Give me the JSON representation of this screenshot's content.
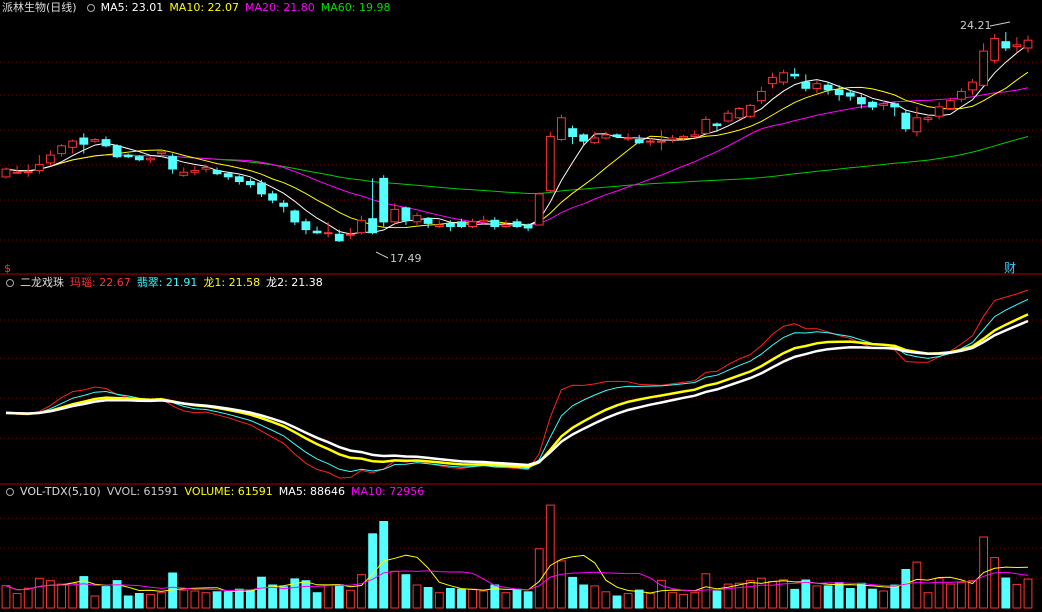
{
  "panels": {
    "main": {
      "stock_name": "派林生物(日线)",
      "indicators": [
        {
          "label": "MA5: 23.01",
          "color": "#ffffff"
        },
        {
          "label": "MA10: 22.07",
          "color": "#ffff00"
        },
        {
          "label": "MA20: 21.80",
          "color": "#ff00ff"
        },
        {
          "label": "MA60: 19.98",
          "color": "#00dd00"
        }
      ],
      "high_label": "24.21",
      "low_label": "17.49",
      "badge_left": "$",
      "badge_right": "财"
    },
    "mid": {
      "title": "二龙戏珠",
      "indicators": [
        {
          "label": "玛瑙: 22.67",
          "color": "#ff3333"
        },
        {
          "label": "翡翠: 21.91",
          "color": "#33ffff"
        },
        {
          "label": "龙1: 21.58",
          "color": "#ffff00"
        },
        {
          "label": "龙2: 21.38",
          "color": "#ffffff"
        }
      ]
    },
    "vol": {
      "title": "VOL-TDX(5,10)",
      "indicators": [
        {
          "label": "VVOL: 61591",
          "color": "#cccccc"
        },
        {
          "label": "VOLUME: 61591",
          "color": "#ffff00"
        },
        {
          "label": "MA5: 88646",
          "color": "#ffffff"
        },
        {
          "label": "MA10: 72956",
          "color": "#ff00ff"
        }
      ]
    }
  },
  "chart_data": {
    "type": "candlestick",
    "ylim": [
      17.0,
      24.6
    ],
    "candles": [
      [
        19.55,
        19.8,
        19.85,
        19.5
      ],
      [
        19.7,
        19.7,
        19.9,
        19.65
      ],
      [
        19.7,
        19.72,
        19.95,
        19.55
      ],
      [
        19.75,
        19.95,
        20.25,
        19.65
      ],
      [
        20.0,
        20.25,
        20.4,
        19.9
      ],
      [
        20.3,
        20.55,
        20.6,
        20.2
      ],
      [
        20.5,
        20.7,
        20.75,
        20.3
      ],
      [
        20.8,
        20.6,
        20.95,
        20.3
      ],
      [
        20.7,
        20.75,
        20.8,
        20.65
      ],
      [
        20.75,
        20.55,
        20.85,
        20.5
      ],
      [
        20.55,
        20.2,
        20.6,
        20.15
      ],
      [
        20.25,
        20.2,
        20.3,
        20.15
      ],
      [
        20.2,
        20.1,
        20.25,
        20.05
      ],
      [
        20.1,
        20.15,
        20.2,
        20.0
      ],
      [
        20.3,
        20.35,
        20.45,
        20.2
      ],
      [
        20.2,
        19.8,
        20.3,
        19.65
      ],
      [
        19.6,
        19.7,
        19.85,
        19.55
      ],
      [
        19.7,
        19.75,
        19.9,
        19.6
      ],
      [
        19.8,
        19.85,
        19.95,
        19.7
      ],
      [
        19.75,
        19.65,
        19.85,
        19.6
      ],
      [
        19.65,
        19.55,
        19.7,
        19.45
      ],
      [
        19.55,
        19.4,
        19.6,
        19.3
      ],
      [
        19.4,
        19.3,
        19.5,
        19.2
      ],
      [
        19.35,
        19.0,
        19.45,
        18.9
      ],
      [
        19.0,
        18.8,
        19.1,
        18.7
      ],
      [
        18.7,
        18.6,
        18.8,
        18.4
      ],
      [
        18.45,
        18.1,
        18.5,
        18.0
      ],
      [
        18.1,
        17.85,
        18.2,
        17.7
      ],
      [
        17.8,
        17.75,
        17.95,
        17.7
      ],
      [
        17.75,
        17.75,
        18.1,
        17.6
      ],
      [
        17.7,
        17.49,
        17.85,
        17.45
      ],
      [
        17.7,
        17.7,
        17.9,
        17.55
      ],
      [
        17.75,
        18.15,
        18.3,
        17.7
      ],
      [
        18.2,
        17.75,
        19.5,
        17.7
      ],
      [
        19.5,
        18.1,
        19.6,
        17.95
      ],
      [
        18.1,
        18.5,
        18.7,
        18.0
      ],
      [
        18.55,
        18.15,
        18.6,
        18.0
      ],
      [
        18.1,
        18.3,
        18.4,
        18.0
      ],
      [
        18.2,
        18.05,
        18.25,
        17.9
      ],
      [
        17.95,
        18.0,
        18.15,
        17.9
      ],
      [
        18.05,
        17.95,
        18.15,
        17.8
      ],
      [
        18.1,
        17.95,
        18.2,
        17.9
      ],
      [
        17.95,
        18.1,
        18.2,
        17.9
      ],
      [
        18.1,
        18.15,
        18.3,
        18.0
      ],
      [
        18.15,
        17.95,
        18.25,
        17.85
      ],
      [
        17.95,
        18.0,
        18.15,
        17.9
      ],
      [
        18.1,
        17.95,
        18.2,
        17.9
      ],
      [
        18.0,
        17.9,
        18.05,
        17.8
      ],
      [
        18.0,
        19.0,
        19.05,
        18.0
      ],
      [
        19.1,
        20.85,
        21.0,
        19.05
      ],
      [
        20.75,
        21.45,
        21.55,
        20.7
      ],
      [
        21.1,
        20.85,
        21.2,
        20.6
      ],
      [
        20.9,
        20.7,
        20.95,
        20.55
      ],
      [
        20.65,
        20.8,
        21.0,
        20.6
      ],
      [
        20.8,
        20.9,
        21.0,
        20.75
      ],
      [
        20.9,
        20.85,
        20.95,
        20.8
      ],
      [
        20.8,
        20.8,
        20.95,
        20.7
      ],
      [
        20.75,
        20.65,
        20.9,
        20.6
      ],
      [
        20.7,
        20.7,
        20.8,
        20.55
      ],
      [
        20.7,
        20.7,
        21.05,
        20.4
      ],
      [
        20.75,
        20.8,
        20.9,
        20.65
      ],
      [
        20.8,
        20.85,
        20.9,
        20.7
      ],
      [
        20.85,
        20.9,
        21.05,
        20.8
      ],
      [
        20.95,
        21.4,
        21.5,
        20.9
      ],
      [
        21.25,
        21.2,
        21.3,
        21.0
      ],
      [
        21.35,
        21.6,
        21.7,
        21.3
      ],
      [
        21.45,
        21.75,
        21.8,
        21.4
      ],
      [
        21.5,
        21.85,
        21.9,
        21.45
      ],
      [
        22.0,
        22.3,
        22.45,
        21.9
      ],
      [
        22.55,
        22.75,
        22.9,
        22.4
      ],
      [
        22.6,
        22.9,
        23.0,
        22.5
      ],
      [
        22.85,
        22.8,
        23.05,
        22.7
      ],
      [
        22.6,
        22.4,
        22.85,
        22.3
      ],
      [
        22.4,
        22.55,
        22.65,
        22.25
      ],
      [
        22.5,
        22.35,
        22.6,
        22.2
      ],
      [
        22.35,
        22.2,
        22.5,
        22.0
      ],
      [
        22.25,
        22.15,
        22.35,
        22.0
      ],
      [
        22.1,
        21.9,
        22.2,
        21.75
      ],
      [
        21.95,
        21.8,
        22.0,
        21.7
      ],
      [
        21.85,
        21.9,
        22.0,
        21.7
      ],
      [
        21.9,
        21.8,
        21.95,
        21.5
      ],
      [
        21.6,
        21.1,
        21.7,
        21.0
      ],
      [
        21.0,
        21.45,
        21.8,
        20.85
      ],
      [
        21.4,
        21.45,
        21.55,
        21.3
      ],
      [
        21.5,
        21.8,
        21.95,
        21.4
      ],
      [
        21.75,
        22.0,
        22.1,
        21.7
      ],
      [
        22.05,
        22.3,
        22.4,
        21.95
      ],
      [
        22.35,
        22.6,
        22.7,
        22.2
      ],
      [
        22.5,
        23.6,
        23.85,
        22.5
      ],
      [
        23.3,
        24.0,
        24.15,
        23.2
      ],
      [
        23.9,
        23.7,
        24.21,
        23.6
      ],
      [
        23.75,
        23.8,
        24.05,
        23.55
      ],
      [
        23.7,
        23.95,
        24.1,
        23.55
      ]
    ]
  }
}
